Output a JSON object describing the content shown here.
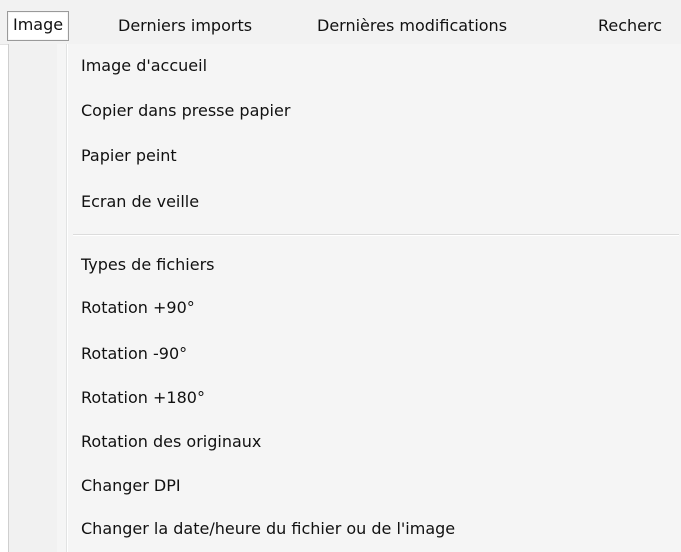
{
  "menubar": {
    "items": [
      {
        "label": "Image",
        "active": true
      },
      {
        "label": "Derniers imports",
        "active": false
      },
      {
        "label": "Dernières modifications",
        "active": false
      },
      {
        "label": "Recherc",
        "active": false
      }
    ]
  },
  "dropdown": {
    "group1": [
      {
        "label": "Image d'accueil"
      },
      {
        "label": "Copier dans presse papier"
      },
      {
        "label": "Papier peint"
      },
      {
        "label": "Ecran de veille"
      }
    ],
    "group2": [
      {
        "label": "Types de fichiers"
      },
      {
        "label": "Rotation +90°"
      },
      {
        "label": "Rotation -90°"
      },
      {
        "label": "Rotation +180°"
      },
      {
        "label": "Rotation des originaux"
      },
      {
        "label": "Changer DPI"
      },
      {
        "label": "Changer la date/heure du fichier ou de l'image"
      }
    ]
  }
}
